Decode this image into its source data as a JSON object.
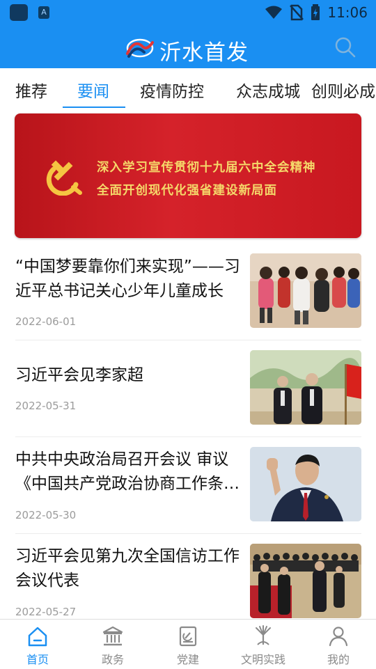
{
  "status_bar": {
    "time": "11:06"
  },
  "app_bar": {
    "title": "沂水首发"
  },
  "tabs": [
    {
      "label": "推荐"
    },
    {
      "label": "要闻"
    },
    {
      "label": "疫情防控"
    },
    {
      "label": "众志成城"
    },
    {
      "label": "创则必成"
    }
  ],
  "active_tab": "要闻",
  "banner": {
    "line1": "深入学习宣传贯彻十九届六中全会精神",
    "line2": "全面开创现代化强省建设新局面"
  },
  "news": [
    {
      "title": "“中国梦要靠你们来实现”——习近平总书记关心少年儿童成长",
      "date": "2022-06-01"
    },
    {
      "title": "习近平会见李家超",
      "date": "2022-05-31"
    },
    {
      "title": "中共中央政治局召开会议 审议《中国共产党政治协商工作条例》",
      "date": "2022-05-30"
    },
    {
      "title": "习近平会见第九次全国信访工作会议代表",
      "date": "2022-05-27"
    }
  ],
  "bottom_nav": [
    {
      "label": "首页",
      "icon": "home-icon"
    },
    {
      "label": "政务",
      "icon": "government-building-icon"
    },
    {
      "label": "党建",
      "icon": "party-book-icon"
    },
    {
      "label": "文明实践",
      "icon": "civilization-practice-icon"
    },
    {
      "label": "我的",
      "icon": "person-icon"
    }
  ],
  "colors": {
    "primary": "#1a8ff2",
    "banner_red": "#c8161d",
    "banner_text": "#f5d86a"
  }
}
